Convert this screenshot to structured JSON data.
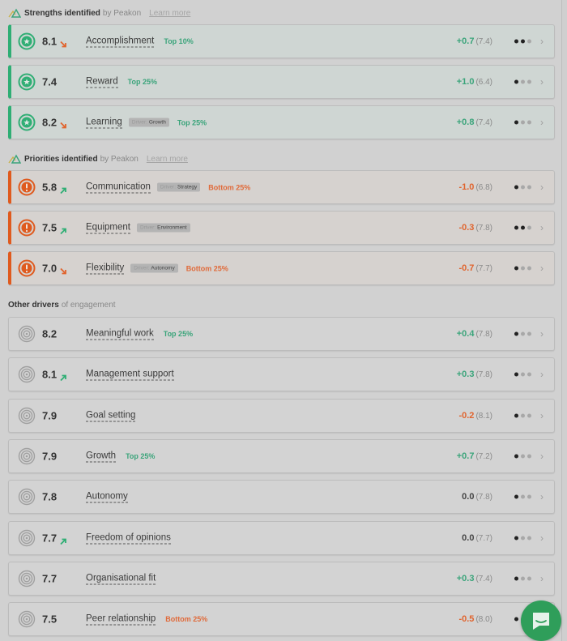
{
  "colors": {
    "strength_accent": "#2fae74",
    "priority_accent": "#df5a1e",
    "positive": "#3aa47a",
    "negative": "#e0642e",
    "chat_button": "#2f9e5a"
  },
  "sections": {
    "strengths": {
      "title": "Strengths identified",
      "by": "by Peakon",
      "learn_more": "Learn more",
      "icon": "peakon-mountain-icon"
    },
    "priorities": {
      "title": "Priorities identified",
      "by": "by Peakon",
      "learn_more": "Learn more",
      "icon": "peakon-mountain-icon"
    },
    "other": {
      "title": "Other drivers",
      "by": "of engagement"
    }
  },
  "strengths": [
    {
      "score": "8.1",
      "trend": "down",
      "name": "Accomplishment",
      "tag_prefix": "",
      "tag": "",
      "rank": "Top 10%",
      "rank_type": "top",
      "delta": "+0.7",
      "delta_type": "pos",
      "prev": "(7.4)",
      "dots": 2,
      "icon": "star-icon"
    },
    {
      "score": "7.4",
      "trend": "",
      "name": "Reward",
      "tag_prefix": "",
      "tag": "",
      "rank": "Top 25%",
      "rank_type": "top",
      "delta": "+1.0",
      "delta_type": "pos",
      "prev": "(6.4)",
      "dots": 1,
      "icon": "star-icon"
    },
    {
      "score": "8.2",
      "trend": "down",
      "name": "Learning",
      "tag_prefix": "Driver:",
      "tag": "Growth",
      "rank": "Top 25%",
      "rank_type": "top",
      "delta": "+0.8",
      "delta_type": "pos",
      "prev": "(7.4)",
      "dots": 1,
      "icon": "star-icon"
    }
  ],
  "priorities": [
    {
      "score": "5.8",
      "trend": "up",
      "name": "Communication",
      "tag_prefix": "Driver:",
      "tag": "Strategy",
      "rank": "Bottom 25%",
      "rank_type": "bottom",
      "delta": "-1.0",
      "delta_type": "neg",
      "prev": "(6.8)",
      "dots": 1,
      "icon": "exclamation-icon"
    },
    {
      "score": "7.5",
      "trend": "up",
      "name": "Equipment",
      "tag_prefix": "Driver:",
      "tag": "Environment",
      "rank": "",
      "rank_type": "",
      "delta": "-0.3",
      "delta_type": "neg",
      "prev": "(7.8)",
      "dots": 2,
      "icon": "exclamation-icon"
    },
    {
      "score": "7.0",
      "trend": "down",
      "name": "Flexibility",
      "tag_prefix": "Driver:",
      "tag": "Autonomy",
      "rank": "Bottom 25%",
      "rank_type": "bottom",
      "delta": "-0.7",
      "delta_type": "neg",
      "prev": "(7.7)",
      "dots": 1,
      "icon": "exclamation-icon"
    }
  ],
  "others": [
    {
      "score": "8.2",
      "trend": "",
      "name": "Meaningful work",
      "rank": "Top 25%",
      "rank_type": "top",
      "delta": "+0.4",
      "delta_type": "pos",
      "prev": "(7.8)",
      "dots": 1
    },
    {
      "score": "8.1",
      "trend": "up",
      "name": "Management support",
      "rank": "",
      "rank_type": "",
      "delta": "+0.3",
      "delta_type": "pos",
      "prev": "(7.8)",
      "dots": 1
    },
    {
      "score": "7.9",
      "trend": "",
      "name": "Goal setting",
      "rank": "",
      "rank_type": "",
      "delta": "-0.2",
      "delta_type": "neg",
      "prev": "(8.1)",
      "dots": 1
    },
    {
      "score": "7.9",
      "trend": "",
      "name": "Growth",
      "rank": "Top 25%",
      "rank_type": "top",
      "delta": "+0.7",
      "delta_type": "pos",
      "prev": "(7.2)",
      "dots": 1
    },
    {
      "score": "7.8",
      "trend": "",
      "name": "Autonomy",
      "rank": "",
      "rank_type": "",
      "delta": "0.0",
      "delta_type": "zero",
      "prev": "(7.8)",
      "dots": 1
    },
    {
      "score": "7.7",
      "trend": "up",
      "name": "Freedom of opinions",
      "rank": "",
      "rank_type": "",
      "delta": "0.0",
      "delta_type": "zero",
      "prev": "(7.7)",
      "dots": 1
    },
    {
      "score": "7.7",
      "trend": "",
      "name": "Organisational fit",
      "rank": "",
      "rank_type": "",
      "delta": "+0.3",
      "delta_type": "pos",
      "prev": "(7.4)",
      "dots": 1
    },
    {
      "score": "7.5",
      "trend": "",
      "name": "Peer relationship",
      "rank": "Bottom 25%",
      "rank_type": "bottom",
      "delta": "-0.5",
      "delta_type": "neg",
      "prev": "(8.0)",
      "dots": 1
    }
  ],
  "chat": {
    "icon": "chat-bubble-icon"
  }
}
